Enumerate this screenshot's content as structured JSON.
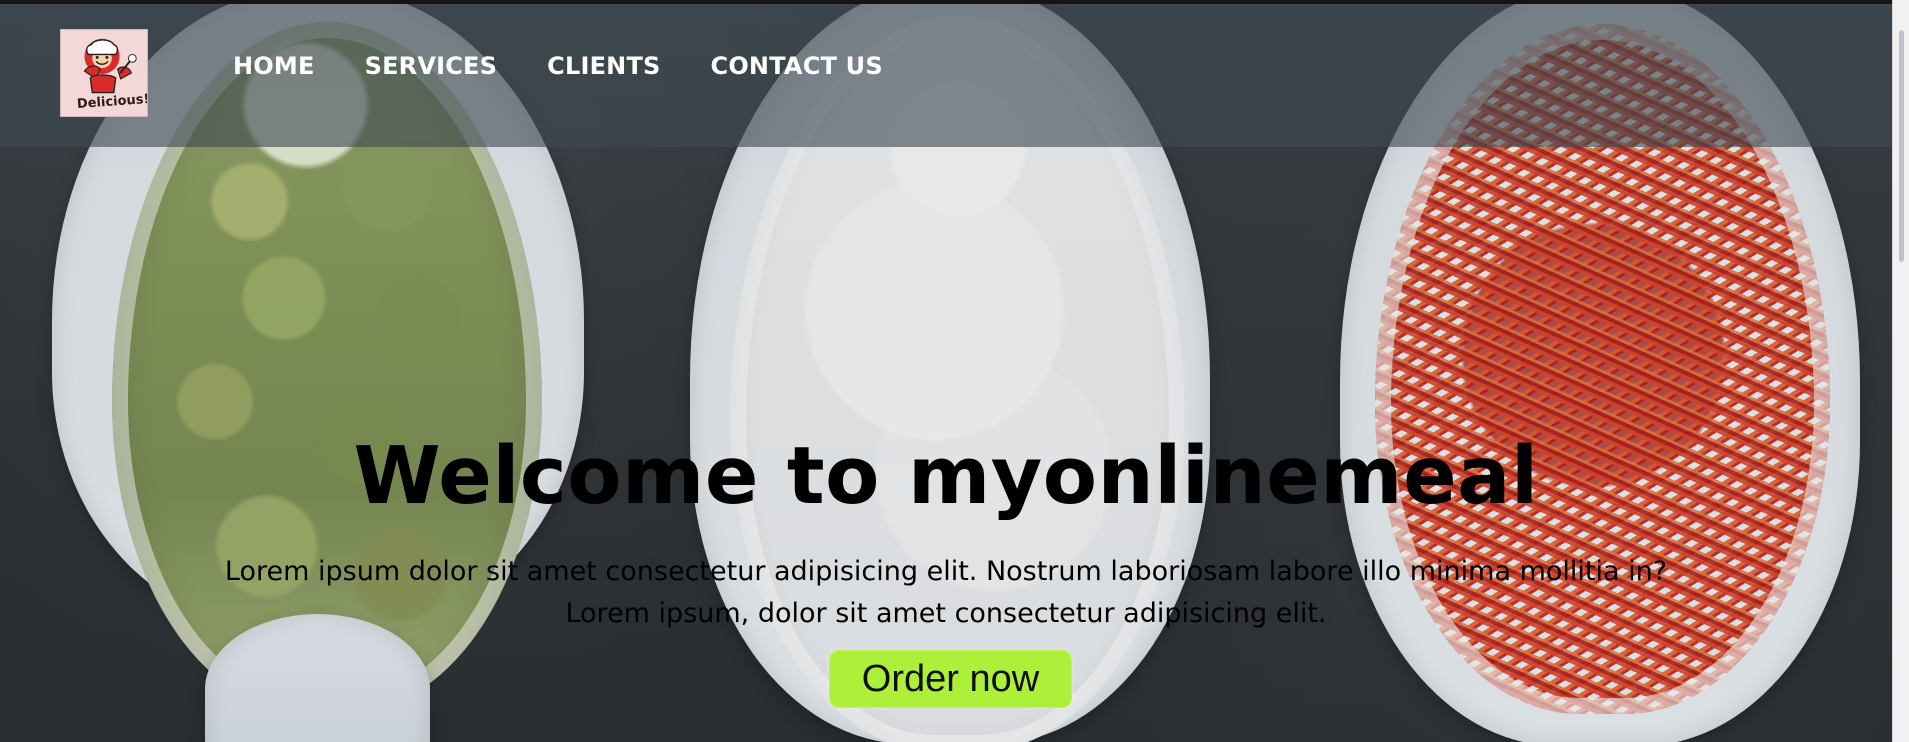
{
  "header": {
    "logo_alt": "Delicious!",
    "nav": [
      {
        "label": "HOME"
      },
      {
        "label": "SERVICES"
      },
      {
        "label": "CLIENTS"
      },
      {
        "label": "CONTACT US"
      }
    ]
  },
  "hero": {
    "title": "Welcome to myonlinemeal",
    "subtitle_line1": "Lorem ipsum dolor sit amet consectetur adipisicing elit. Nostrum laboriosam labore illo minima mollitia in?",
    "subtitle_line2": "Lorem ipsum, dolor sit amet consectetur adipisicing elit.",
    "button_label": "Order now"
  },
  "colors": {
    "header_overlay": "#3E4A52",
    "button_bg": "#ADF03A",
    "text": "#000000",
    "nav_text": "#FFFFFF"
  }
}
